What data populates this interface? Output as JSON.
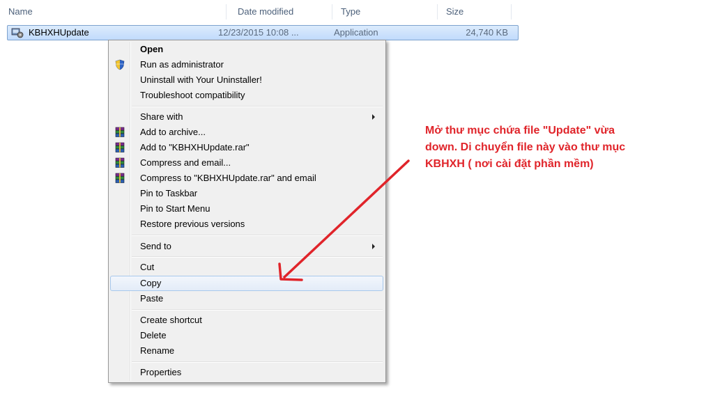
{
  "columns": {
    "name": "Name",
    "date_modified": "Date modified",
    "type": "Type",
    "size": "Size"
  },
  "file": {
    "name": "KBHXHUpdate",
    "date": "12/23/2015 10:08 ...",
    "type": "Application",
    "size": "24,740 KB",
    "icon": "application-exe-icon"
  },
  "menu": {
    "open": "Open",
    "run_as_admin": "Run as administrator",
    "uninstall": "Uninstall with Your Uninstaller!",
    "troubleshoot": "Troubleshoot compatibility",
    "share_with": "Share with",
    "add_archive": "Add to archive...",
    "add_to_rar": "Add to \"KBHXHUpdate.rar\"",
    "compress_email": "Compress and email...",
    "compress_rar_email": "Compress to \"KBHXHUpdate.rar\" and email",
    "pin_taskbar": "Pin to Taskbar",
    "pin_start": "Pin to Start Menu",
    "restore": "Restore previous versions",
    "send_to": "Send to",
    "cut": "Cut",
    "copy": "Copy",
    "paste": "Paste",
    "create_shortcut": "Create shortcut",
    "delete": "Delete",
    "rename": "Rename",
    "properties": "Properties"
  },
  "annotation": {
    "line1": "Mở thư mục chứa file \"Update\" vừa",
    "line2": "down. Di chuyển file này vào thư mục",
    "line3": "KBHXH ( nơi cài đặt phần mềm)",
    "color": "#e0242a"
  }
}
